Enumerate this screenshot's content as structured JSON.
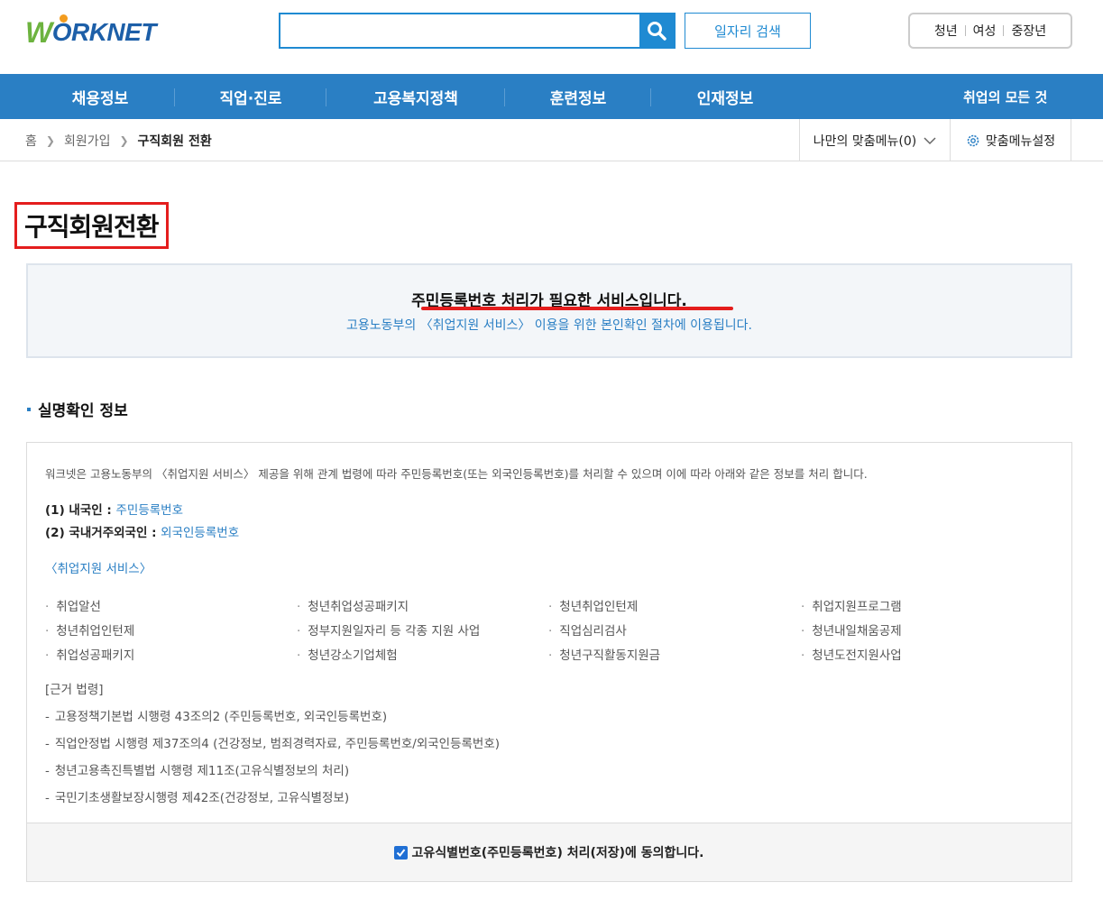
{
  "header": {
    "logo_w": "W",
    "logo_rest": "ORKNET",
    "search": {
      "value": "",
      "placeholder": ""
    },
    "job_search_label": "일자리 검색",
    "quick_links": [
      "청년",
      "여성",
      "중장년"
    ]
  },
  "gnb": {
    "items": [
      "채용정보",
      "직업·진로",
      "고용복지정책",
      "훈련정보",
      "인재정보"
    ],
    "right_label": "취업의 모든 것"
  },
  "breadcrumb": {
    "home": "홈",
    "level1": "회원가입",
    "current": "구직회원 전환"
  },
  "custom_menu": {
    "my_menu_label": "나만의 맞춤메뉴(0)",
    "settings_label": "맞춤메뉴설정"
  },
  "page_title": "구직회원전환",
  "notice": {
    "main": "주민등록번호 처리가 필요한 서비스입니다.",
    "sub": "고용노동부의 〈취업지원 서비스〉 이용을 위한 본인확인 절차에 이용됩니다."
  },
  "section_title": "실명확인 정보",
  "info": {
    "intro": "워크넷은 고용노동부의 〈취업지원 서비스〉 제공을 위해 관계 법령에 따라 주민등록번호(또는 외국인등록번호)를 처리할 수 있으며 이에 따라 아래와 같은 정보를 처리 합니다.",
    "id1_label": "(1) 내국인 : ",
    "id1_value": "주민등록번호",
    "id2_label": "(2) 국내거주외국인 : ",
    "id2_value": "외국인등록번호",
    "service_title": "〈취업지원 서비스〉",
    "services": [
      "취업알선",
      "청년취업성공패키지",
      "청년취업인턴제",
      "취업지원프로그램",
      "청년취업인턴제",
      "정부지원일자리 등 각종 지원 사업",
      "직업심리검사",
      "청년내일채움공제",
      "취업성공패키지",
      "청년강소기업체험",
      "청년구직활동지원금",
      "청년도전지원사업"
    ],
    "law_title": "[근거 법령]",
    "laws": [
      "고용정책기본법 시행령 43조의2 (주민등록번호, 외국인등록번호)",
      "직업안정법 시행령 제37조의4 (건강정보, 범죄경력자료, 주민등록번호/외국인등록번호)",
      "청년고용촉진특별법 시행령 제11조(고유식별정보의 처리)",
      "국민기초생활보장시행령 제42조(건강정보, 고유식별정보)"
    ],
    "agree_label": "고유식별번호(주민등록번호) 처리(저장)에 동의합니다.",
    "agree_checked": true
  },
  "colors": {
    "primary_blue": "#2a7fc4",
    "highlight_red": "#e41d1d",
    "logo_green": "#6db33f"
  }
}
